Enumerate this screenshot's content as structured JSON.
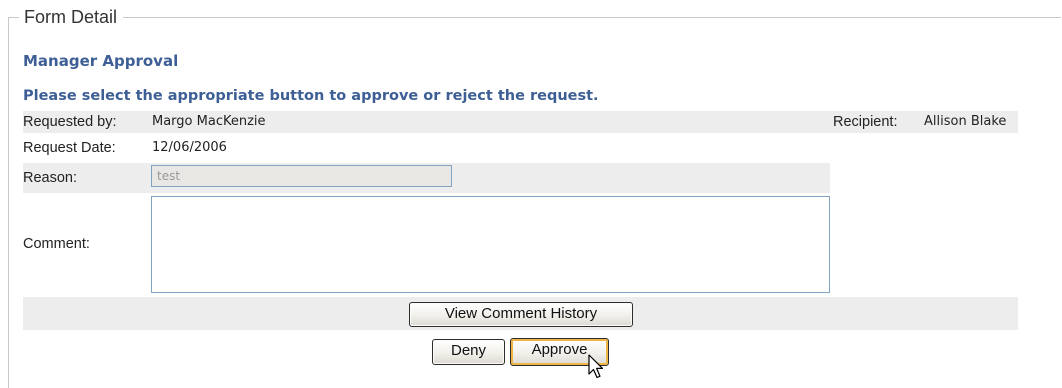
{
  "form": {
    "legend": "Form Detail",
    "title": "Manager Approval",
    "instructions": "Please select the appropriate button to approve or reject the request."
  },
  "fields": {
    "requested_by_label": "Requested by:",
    "requested_by_value": "Margo MacKenzie",
    "recipient_label": "Recipient:",
    "recipient_value": "Allison Blake",
    "request_date_label": "Request Date:",
    "request_date_value": "12/06/2006",
    "reason_label": "Reason:",
    "reason_value": "test",
    "comment_label": "Comment:",
    "comment_value": ""
  },
  "buttons": {
    "view_history": "View Comment History",
    "deny": "Deny",
    "approve": "Approve"
  },
  "colors": {
    "heading": "#3d5f96",
    "row_shade": "#ededed",
    "input_border": "#7fa3c1",
    "approve_focus": "#f0b547"
  },
  "icons": {
    "cursor": "arrow-pointer-icon"
  }
}
